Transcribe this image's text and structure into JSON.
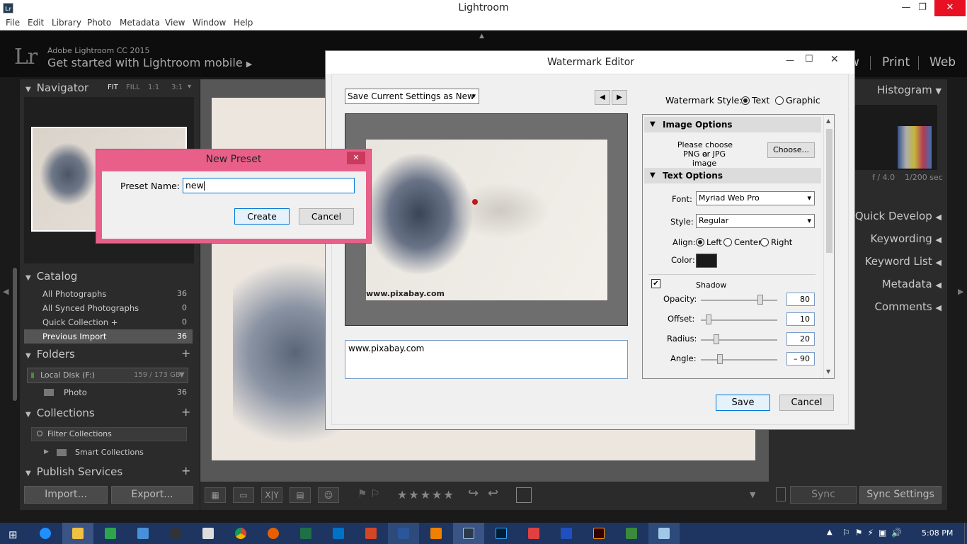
{
  "window": {
    "title": "Lightroom",
    "badge": "Lr",
    "minimize": "—",
    "maximize": "❐",
    "close": "✕"
  },
  "menu": [
    "File",
    "Edit",
    "Library",
    "Photo",
    "Metadata",
    "View",
    "Window",
    "Help"
  ],
  "identity": {
    "logo": "Lr",
    "product": "Adobe Lightroom CC 2015",
    "mobile": "Get started with Lightroom mobile",
    "mobile_arrow": "▶",
    "modules": [
      "w",
      "Print",
      "Web"
    ]
  },
  "navigator": {
    "title": "Navigator",
    "zoom": [
      "FIT",
      "FILL",
      "1:1",
      "3:1"
    ],
    "zoom_arrow": "▾"
  },
  "catalog": {
    "title": "Catalog",
    "items": [
      {
        "label": "All Photographs",
        "count": "36"
      },
      {
        "label": "All Synced Photographs",
        "count": "0"
      },
      {
        "label": "Quick Collection  +",
        "count": "0"
      },
      {
        "label": "Previous Import",
        "count": "36"
      }
    ]
  },
  "folders": {
    "title": "Folders",
    "add": "+",
    "disk": "Local Disk (F:)",
    "disk_usage": "159 / 173 GB",
    "folder": "Photo",
    "folder_count": "36"
  },
  "collections": {
    "title": "Collections",
    "add": "+",
    "filter": "Filter Collections",
    "smart": "Smart Collections"
  },
  "publish": {
    "title": "Publish Services",
    "add": "+"
  },
  "bottom_buttons": {
    "import": "Import...",
    "export": "Export..."
  },
  "right": {
    "histogram": "Histogram",
    "aperture": "f / 4.0",
    "shutter": "1/200 sec",
    "panels": [
      "Quick Develop",
      "Keywording",
      "Keyword List",
      "Metadata",
      "Comments"
    ],
    "sync": "Sync",
    "sync_settings": "Sync Settings"
  },
  "watermark": {
    "title": "Watermark Editor",
    "preset": "Save Current Settings as New",
    "style_label": "Watermark Style:",
    "style_text": "Text",
    "style_graphic": "Graphic",
    "preview_watermark": "www.pixabay.com",
    "text_value": "www.pixabay.com",
    "image_options": "Image Options",
    "choose_hint_1": "Please choose a",
    "choose_hint_2": "PNG or JPG image",
    "choose_button": "Choose...",
    "text_options": "Text Options",
    "font_label": "Font:",
    "font_value": "Myriad Web Pro",
    "style_field_label": "Style:",
    "style_value": "Regular",
    "align_label": "Align:",
    "align_left": "Left",
    "align_center": "Center",
    "align_right": "Right",
    "color_label": "Color:",
    "color_value": "#1a1a1a",
    "shadow_label": "Shadow",
    "opacity_label": "Opacity:",
    "opacity": "80",
    "opacity_frac": 0.78,
    "offset_label": "Offset:",
    "offset": "10",
    "offset_frac": 0.1,
    "radius_label": "Radius:",
    "radius": "20",
    "radius_frac": 0.2,
    "angle_label": "Angle:",
    "angle": "– 90",
    "angle_frac": 0.25,
    "save": "Save",
    "cancel": "Cancel"
  },
  "new_preset": {
    "title": "New Preset",
    "label": "Preset Name:",
    "value": "new",
    "create": "Create",
    "cancel": "Cancel"
  },
  "clock": "5:08 PM",
  "colors": {
    "accent_pink": "#e8608a",
    "taskbar": "#1d3560",
    "panel": "#2b2b2b"
  }
}
